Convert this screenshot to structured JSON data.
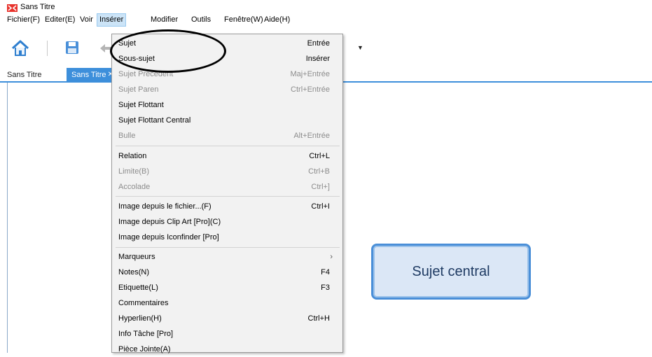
{
  "app": {
    "title": "Sans Titre"
  },
  "menubar": {
    "items": [
      {
        "label": "Fichier(F)"
      },
      {
        "label": "Editer(E)"
      },
      {
        "label": "Voir"
      },
      {
        "label": "Insérer"
      },
      {
        "label": "Modifier"
      },
      {
        "label": "Outils"
      },
      {
        "label": "Fenêtre(W)"
      },
      {
        "label": "Aide(H)"
      }
    ]
  },
  "tabs": {
    "inactive": "Sans Titre",
    "active": "Sans Titre"
  },
  "central_topic": {
    "label": "Sujet central"
  },
  "menu": {
    "items": [
      {
        "label": "Sujet",
        "shortcut": "Entrée"
      },
      {
        "label": "Sous-sujet",
        "shortcut": "Insérer"
      },
      {
        "label": "Sujet Précédent",
        "shortcut": "Maj+Entrée"
      },
      {
        "label": "Sujet Paren",
        "shortcut": "Ctrl+Entrée"
      },
      {
        "label": "Sujet Flottant",
        "shortcut": ""
      },
      {
        "label": "Sujet Flottant Central",
        "shortcut": ""
      },
      {
        "label": "Bulle",
        "shortcut": "Alt+Entrée"
      },
      {
        "label": "Relation",
        "shortcut": "Ctrl+L"
      },
      {
        "label": "Limite(B)",
        "shortcut": "Ctrl+B"
      },
      {
        "label": "Accolade",
        "shortcut": "Ctrl+]"
      },
      {
        "label": "Image depuis le fichier...(F)",
        "shortcut": "Ctrl+I"
      },
      {
        "label": "Image depuis Clip Art [Pro](C)",
        "shortcut": ""
      },
      {
        "label": "Image depuis Iconfinder [Pro]",
        "shortcut": ""
      },
      {
        "label": "Marqueurs",
        "shortcut": ""
      },
      {
        "label": "Notes(N)",
        "shortcut": "F4"
      },
      {
        "label": "Etiquette(L)",
        "shortcut": "F3"
      },
      {
        "label": "Commentaires",
        "shortcut": ""
      },
      {
        "label": "Hyperlien(H)",
        "shortcut": "Ctrl+H"
      },
      {
        "label": "Info Tâche [Pro]",
        "shortcut": ""
      },
      {
        "label": "Pièce Jointe(A)",
        "shortcut": ""
      }
    ]
  },
  "colors": {
    "accent": "#3d8fdb",
    "menu_bg": "#f2f2f2",
    "disabled_text": "#8c8c8c"
  },
  "icons": [
    "app-logo-icon",
    "home-icon",
    "save-icon",
    "undo-icon",
    "dropdown-arrow-icon",
    "chevron-right-icon",
    "tab-close-icon"
  ]
}
